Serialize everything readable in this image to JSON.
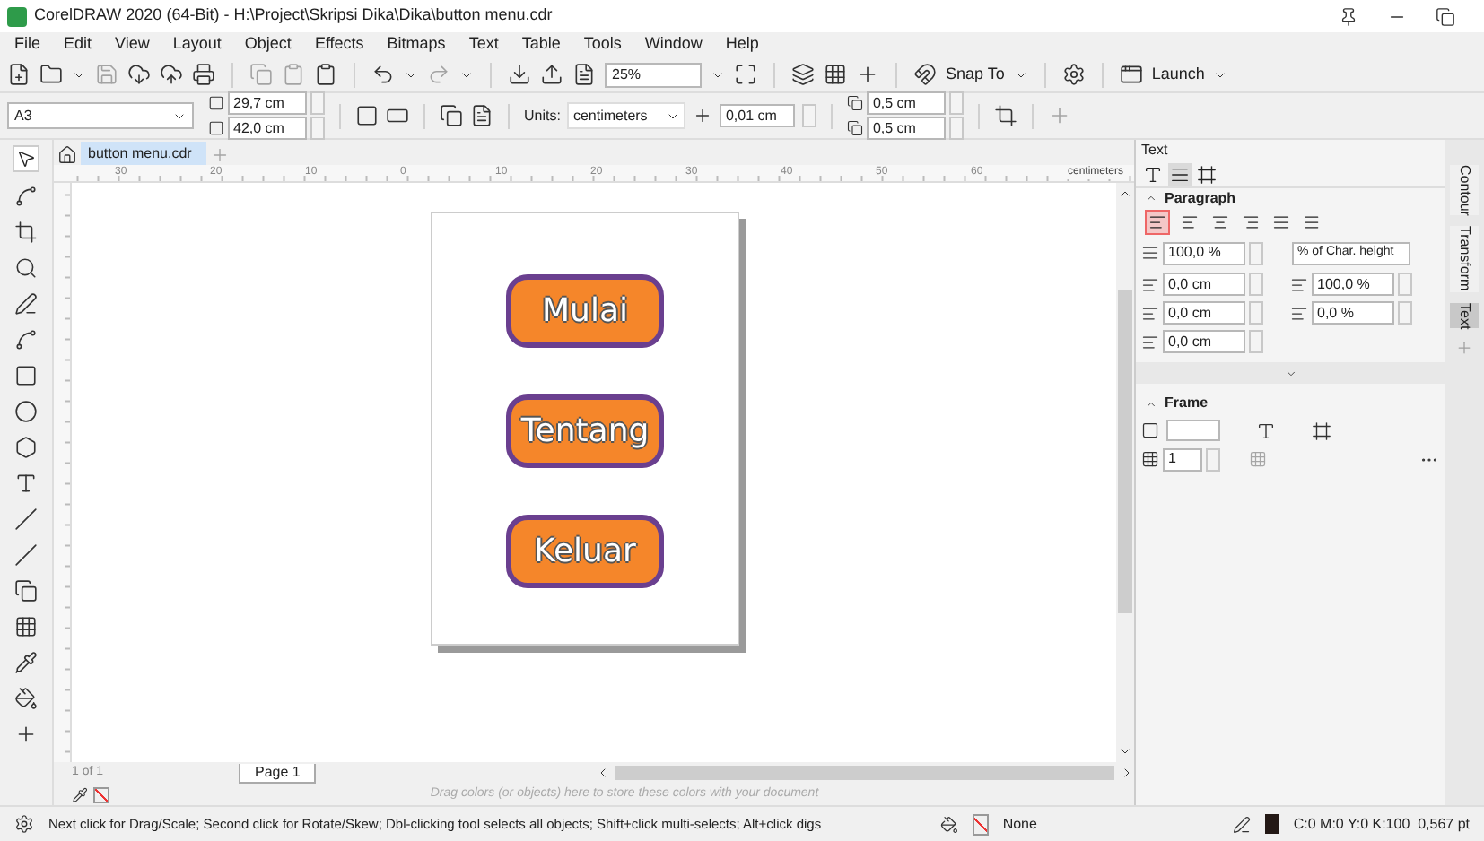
{
  "window": {
    "title": "CorelDRAW 2020 (64-Bit) - H:\\Project\\Skripsi Dika\\Dika\\button menu.cdr"
  },
  "menu": [
    "File",
    "Edit",
    "View",
    "Layout",
    "Object",
    "Effects",
    "Bitmaps",
    "Text",
    "Table",
    "Tools",
    "Window",
    "Help"
  ],
  "toolbar": {
    "zoom": "25%",
    "snap": "Snap To",
    "launch": "Launch"
  },
  "property_bar": {
    "page_size": "A3",
    "width": "29,7 cm",
    "height": "42,0 cm",
    "units_label": "Units:",
    "units": "centimeters",
    "nudge": "0,01 cm",
    "duplicate_x": "0,5 cm",
    "duplicate_y": "0,5 cm"
  },
  "document_tab": {
    "label": "button menu.cdr",
    "selected": true
  },
  "ruler": {
    "labels": [
      "30",
      "20",
      "10",
      "0",
      "10",
      "20",
      "30",
      "40",
      "50",
      "60"
    ],
    "unit": "centimeters"
  },
  "canvas_buttons": [
    "Mulai",
    "Tentang",
    "Keluar"
  ],
  "page_nav": {
    "count": "1 of 1",
    "page_tab": "Page 1"
  },
  "palette": {
    "hint": "Drag colors (or objects) here to store these colors with your document"
  },
  "docker": {
    "title": "Text",
    "tabs": [
      {
        "kind": "character",
        "selected": false
      },
      {
        "kind": "paragraph",
        "selected": true
      },
      {
        "kind": "frame",
        "selected": false
      }
    ],
    "paragraph": {
      "title": "Paragraph",
      "alignments": [
        {
          "kind": "none",
          "selected": true
        },
        {
          "kind": "left",
          "selected": false
        },
        {
          "kind": "center",
          "selected": false
        },
        {
          "kind": "right",
          "selected": false
        },
        {
          "kind": "full",
          "selected": false
        },
        {
          "kind": "force",
          "selected": false
        }
      ],
      "line_spacing": "100,0 %",
      "spacing_unit": "% of Char. height",
      "fields": [
        "0,0 cm",
        "100,0 %",
        "0,0 cm",
        "0,0 %",
        "0,0 cm"
      ]
    },
    "frame": {
      "title": "Frame",
      "columns": "1"
    }
  },
  "side_tabs": [
    {
      "label": "Contour",
      "selected": false
    },
    {
      "label": "Transform",
      "selected": false
    },
    {
      "label": "Text",
      "selected": true
    }
  ],
  "status_bar": {
    "message": "Next click for Drag/Scale; Second click for Rotate/Skew; Dbl-clicking tool selects all objects; Shift+click multi-selects; Alt+click digs",
    "fill": "None",
    "outline": "C:0 M:0 Y:0 K:100  0,567 pt"
  }
}
